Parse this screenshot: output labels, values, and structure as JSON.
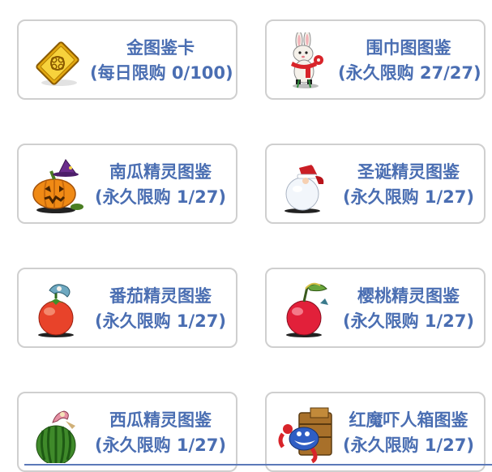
{
  "cards": [
    {
      "name": "金图鉴卡",
      "limit": "(每日限购 0/100)",
      "icon": "gold-card-icon"
    },
    {
      "name": "围巾图图鉴",
      "limit": "(永久限购 27/27)",
      "icon": "scarf-rabbit-icon"
    },
    {
      "name": "南瓜精灵图鉴",
      "limit": "(永久限购 1/27)",
      "icon": "pumpkin-spirit-icon"
    },
    {
      "name": "圣诞精灵图鉴",
      "limit": "(永久限购 1/27)",
      "icon": "christmas-snowball-icon"
    },
    {
      "name": "番茄精灵图鉴",
      "limit": "(永久限购 1/27)",
      "icon": "tomato-spirit-icon"
    },
    {
      "name": "樱桃精灵图鉴",
      "limit": "(永久限购 1/27)",
      "icon": "cherry-spirit-icon"
    },
    {
      "name": "西瓜精灵图鉴",
      "limit": "(永久限购 1/27)",
      "icon": "watermelon-spirit-icon"
    },
    {
      "name": "红魔吓人箱图鉴",
      "limit": "(永久限购 1/27)",
      "icon": "red-devil-box-icon"
    }
  ],
  "colors": {
    "text": "#4a6eb2",
    "border": "#cfcfcf"
  }
}
